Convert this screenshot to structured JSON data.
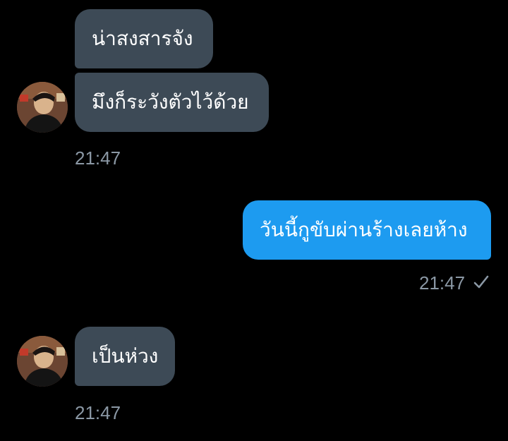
{
  "conversation": {
    "messages": [
      {
        "direction": "incoming",
        "text": "น่าสงสารจัง"
      },
      {
        "direction": "incoming",
        "text": "มึงก็ระวังตัวไว้ด้วย"
      },
      {
        "direction": "outgoing",
        "text": "วันนี้กูขับผ่านร้างเลยห้าง"
      },
      {
        "direction": "incoming",
        "text": "เป็นห่วง"
      }
    ],
    "timestamps": {
      "group1": "21:47",
      "group2": "21:47",
      "group3": "21:47"
    },
    "outgoing_status_icon": "checkmark-icon"
  },
  "colors": {
    "background": "#000000",
    "incoming_bubble": "#3d4a56",
    "outgoing_bubble": "#1d9bf0",
    "timestamp_text": "#8b98a5"
  }
}
